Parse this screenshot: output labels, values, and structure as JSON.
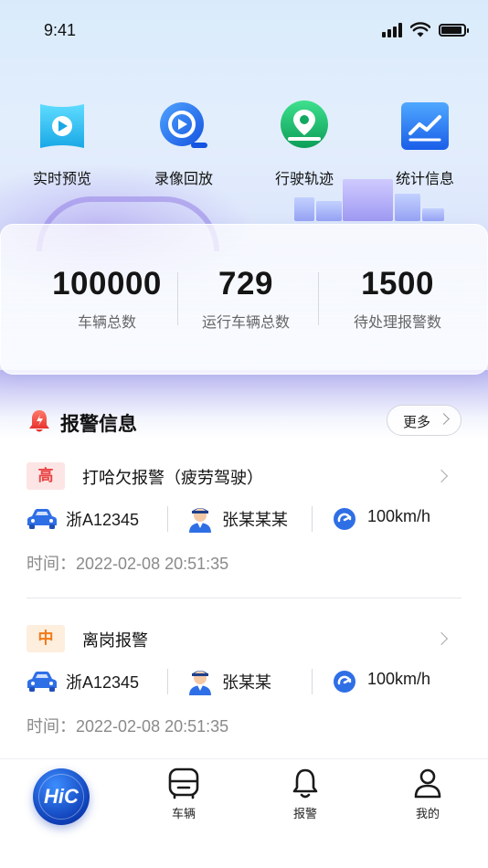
{
  "status_bar": {
    "time": "9:41"
  },
  "quick_actions": [
    {
      "label": "实时预览",
      "icon": "play-video-icon",
      "color": "#2ec4f0"
    },
    {
      "label": "录像回放",
      "icon": "replay-icon",
      "color": "#1e6ff2"
    },
    {
      "label": "行驶轨迹",
      "icon": "map-pin-track-icon",
      "color": "#19b46c"
    },
    {
      "label": "统计信息",
      "icon": "chart-trend-icon",
      "color": "#2b7cf5"
    }
  ],
  "stats": [
    {
      "value": "100000",
      "label": "车辆总数"
    },
    {
      "value": "729",
      "label": "运行车辆总数"
    },
    {
      "value": "1500",
      "label": "待处理报警数"
    }
  ],
  "alarm_section": {
    "title": "报警信息",
    "more_label": "更多"
  },
  "alarms": [
    {
      "level": "高",
      "level_type": "high",
      "title": "打哈欠报警（疲劳驾驶）",
      "plate": "浙A12345",
      "driver": "张某某某",
      "speed": "100km/h",
      "time_label": "时间：",
      "time": "2022-02-08 20:51:35"
    },
    {
      "level": "中",
      "level_type": "mid",
      "title": "离岗报警",
      "plate": "浙A12345",
      "driver": "张某某",
      "speed": "100km/h",
      "time_label": "时间：",
      "time": "2022-02-08 20:51:35"
    }
  ],
  "tabbar": {
    "home_logo": "HiC",
    "tabs": [
      {
        "label": "车辆",
        "icon": "bus-icon"
      },
      {
        "label": "报警",
        "icon": "bell-icon"
      },
      {
        "label": "我的",
        "icon": "user-icon"
      }
    ]
  },
  "colors": {
    "high_level": "#e94545",
    "mid_level": "#f07a1a",
    "accent": "#1e6ff2"
  }
}
